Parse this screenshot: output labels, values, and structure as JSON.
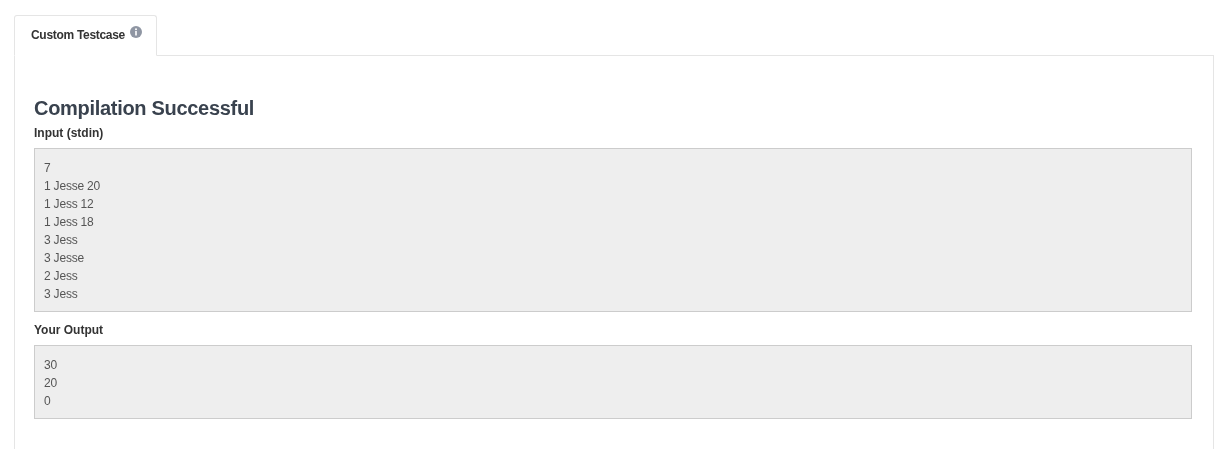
{
  "tabs": [
    {
      "label": "Custom Testcase",
      "selected": true
    }
  ],
  "result": {
    "heading": "Compilation Successful",
    "sections": [
      {
        "label": "Input (stdin)",
        "lines": [
          "7",
          "1 Jesse 20",
          "1 Jess 12",
          "1 Jess 18",
          "3 Jess",
          "3 Jesse",
          "2 Jess",
          "3 Jess"
        ]
      },
      {
        "label": "Your Output",
        "lines": [
          "30",
          "20",
          "0"
        ]
      }
    ]
  }
}
